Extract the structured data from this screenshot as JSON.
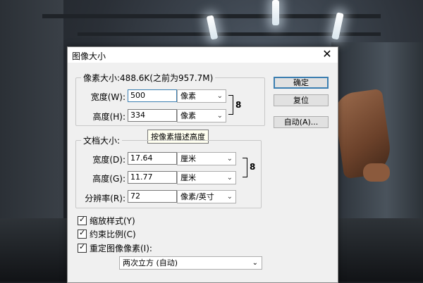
{
  "dialog": {
    "title": "图像大小",
    "close_glyph": "✕",
    "pixel_dims": {
      "legend": "像素大小:488.6K(之前为957.7M)",
      "width_label": "宽度(W):",
      "width_value": "500",
      "width_unit": "像素",
      "height_label": "高度(H):",
      "height_value": "334",
      "height_unit": "像素"
    },
    "tooltip": "按像素描述高度",
    "doc_size": {
      "legend": "文档大小:",
      "width_label": "宽度(D):",
      "width_value": "17.64",
      "width_unit": "厘米",
      "height_label": "高度(G):",
      "height_value": "11.77",
      "height_unit": "厘米",
      "res_label": "分辨率(R):",
      "res_value": "72",
      "res_unit": "像素/英寸"
    },
    "buttons": {
      "ok": "确定",
      "reset": "复位",
      "auto": "自动(A)..."
    },
    "checkboxes": {
      "scale_styles": "缩放样式(Y)",
      "constrain": "约束比例(C)",
      "resample": "重定图像像素(I):"
    },
    "resample_method": "两次立方 (自动)"
  }
}
